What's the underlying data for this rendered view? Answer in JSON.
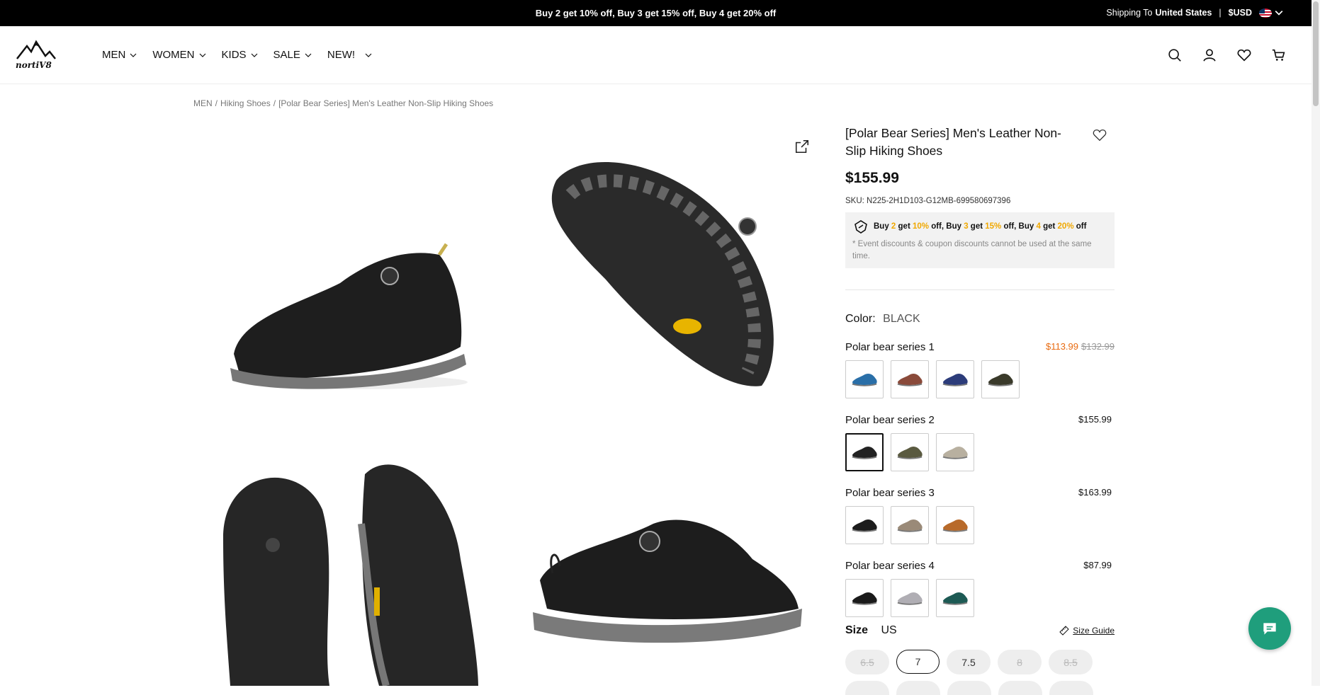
{
  "topbar": {
    "promo": "Buy 2 get 10% off, Buy 3 get 15% off, Buy 4 get 20% off",
    "ship_label": "Shipping To",
    "ship_country": "United States",
    "sep": "|",
    "currency": "$USD"
  },
  "header": {
    "nav": [
      "MEN",
      "WOMEN",
      "KIDS",
      "SALE",
      "NEW!"
    ]
  },
  "breadcrumb": [
    "MEN",
    "/",
    "Hiking Shoes",
    "/",
    "[Polar Bear Series] Men's Leather Non-Slip Hiking Shoes"
  ],
  "product": {
    "title": "[Polar Bear Series] Men's Leather Non-Slip Hiking Shoes",
    "price": "$155.99",
    "sku": "SKU: N225-2H1D103-G12MB-699580697396",
    "promo": {
      "parts": [
        "Buy ",
        "2",
        " get ",
        "10%",
        " off, Buy ",
        "3",
        " get ",
        "15%",
        " off, Buy ",
        "4",
        " get ",
        "20%",
        " off"
      ],
      "note": "* Event discounts & coupon discounts cannot be used at the same time."
    },
    "color_label": "Color:",
    "color_value": "BLACK",
    "series": [
      {
        "name": "Polar bear series 1",
        "price": "$113.99",
        "orig": "$132.99",
        "swatches": [
          "#2a6fa8",
          "#8a4a3a",
          "#2c3c7a",
          "#3a3a2a"
        ]
      },
      {
        "name": "Polar bear series 2",
        "price": "$155.99",
        "orig": "",
        "swatches": [
          "#222222",
          "#5a5a40",
          "#b8b0a0"
        ]
      },
      {
        "name": "Polar bear series 3",
        "price": "$163.99",
        "orig": "",
        "swatches": [
          "#1c1c1c",
          "#9a8a78",
          "#b86a2a"
        ]
      },
      {
        "name": "Polar bear series 4",
        "price": "$87.99",
        "orig": "",
        "swatches": [
          "#1a1a1a",
          "#b0aeb4",
          "#1d5a54"
        ]
      }
    ],
    "size_label": "Size",
    "size_unit": "US",
    "size_guide": "Size Guide",
    "sizes": [
      {
        "label": "6.5",
        "state": "disabled"
      },
      {
        "label": "7",
        "state": "selected"
      },
      {
        "label": "7.5",
        "state": "available"
      },
      {
        "label": "8",
        "state": "disabled"
      },
      {
        "label": "8.5",
        "state": "disabled"
      }
    ]
  },
  "colors": {
    "accent_sale": "#e86a10",
    "promo_highlight": "#f0a800",
    "chat": "#1f9e7c"
  }
}
